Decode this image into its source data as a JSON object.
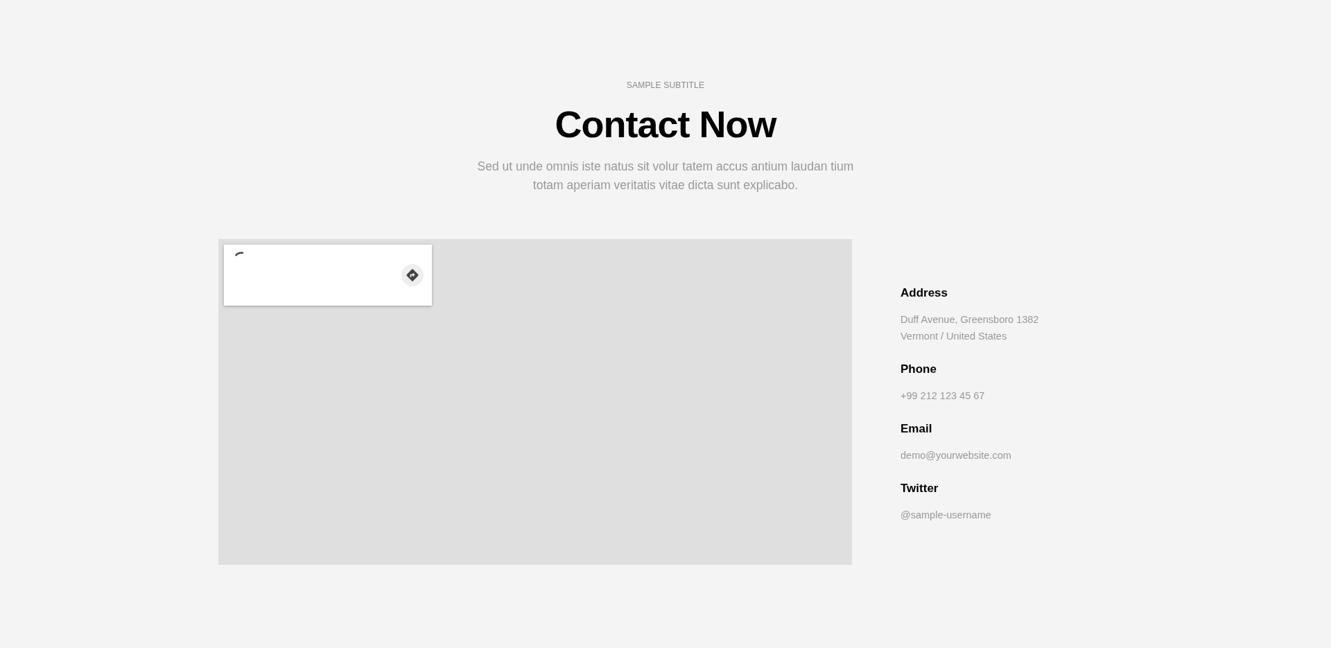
{
  "header": {
    "subtitle": "SAMPLE SUBTITLE",
    "title": "Contact Now",
    "lines": [
      "Sed ut unde omnis iste natus sit volur tatem accus antium laudan tium",
      "totam aperiam veritatis vitae dicta sunt explicabo."
    ]
  },
  "map": {
    "loading": true
  },
  "contacts": [
    {
      "label": "Address",
      "lines": [
        "Duff Avenue, Greensboro 1382",
        "Vermont / United States"
      ]
    },
    {
      "label": "Phone",
      "lines": [
        "+99 212 123 45 67"
      ]
    },
    {
      "label": "Email",
      "lines": [
        "demo@yourwebsite.com"
      ]
    },
    {
      "label": "Twitter",
      "lines": [
        "@sample-username"
      ]
    }
  ]
}
